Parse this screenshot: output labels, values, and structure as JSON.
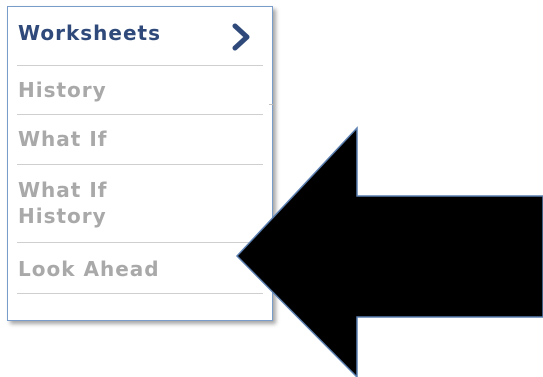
{
  "menu": {
    "items": [
      {
        "label": "Worksheets",
        "active": true
      },
      {
        "label": "History",
        "active": false
      },
      {
        "label": "What If",
        "active": false
      },
      {
        "label": "What If History",
        "active": false
      },
      {
        "label": "Look Ahead",
        "active": false
      }
    ]
  },
  "colors": {
    "active_text": "#2f4a7a",
    "inactive_text": "#a9a9a9",
    "panel_border": "#7a9cc8",
    "arrow_fill": "#000000",
    "arrow_outline": "#5b7fb0"
  },
  "icons": {
    "chevron": "chevron-right-icon",
    "pointer": "arrow-left-icon"
  }
}
